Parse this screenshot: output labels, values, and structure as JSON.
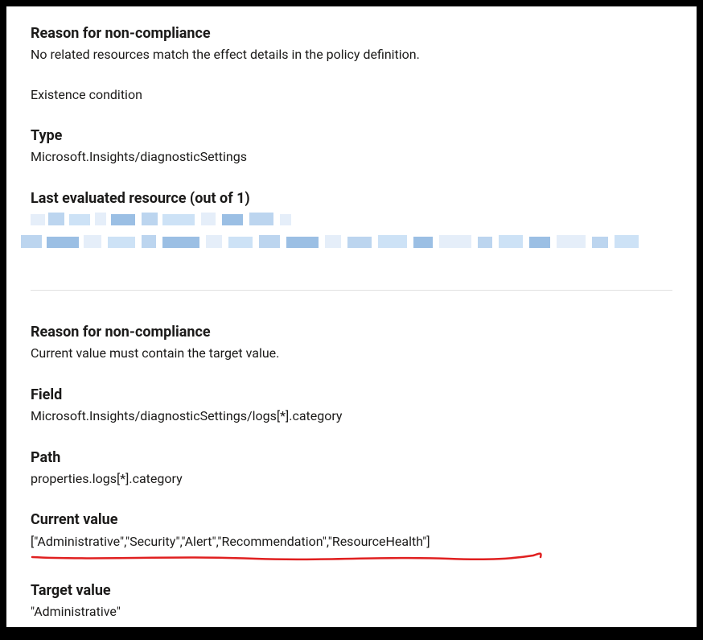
{
  "reason1": {
    "heading": "Reason for non-compliance",
    "text": "No related resources match the effect details in the policy definition."
  },
  "existence_condition": "Existence condition",
  "type": {
    "heading": "Type",
    "value": "Microsoft.Insights/diagnosticSettings"
  },
  "last_evaluated": {
    "heading": "Last evaluated resource (out of 1)"
  },
  "reason2": {
    "heading": "Reason for non-compliance",
    "text": "Current value must contain the target value."
  },
  "field": {
    "heading": "Field",
    "value": "Microsoft.Insights/diagnosticSettings/logs[*].category"
  },
  "path": {
    "heading": "Path",
    "value": "properties.logs[*].category"
  },
  "current_value": {
    "heading": "Current value",
    "value": "[\"Administrative\",\"Security\",\"Alert\",\"Recommendation\",\"ResourceHealth\"]"
  },
  "target_value": {
    "heading": "Target value",
    "value": "\"Administrative\""
  }
}
